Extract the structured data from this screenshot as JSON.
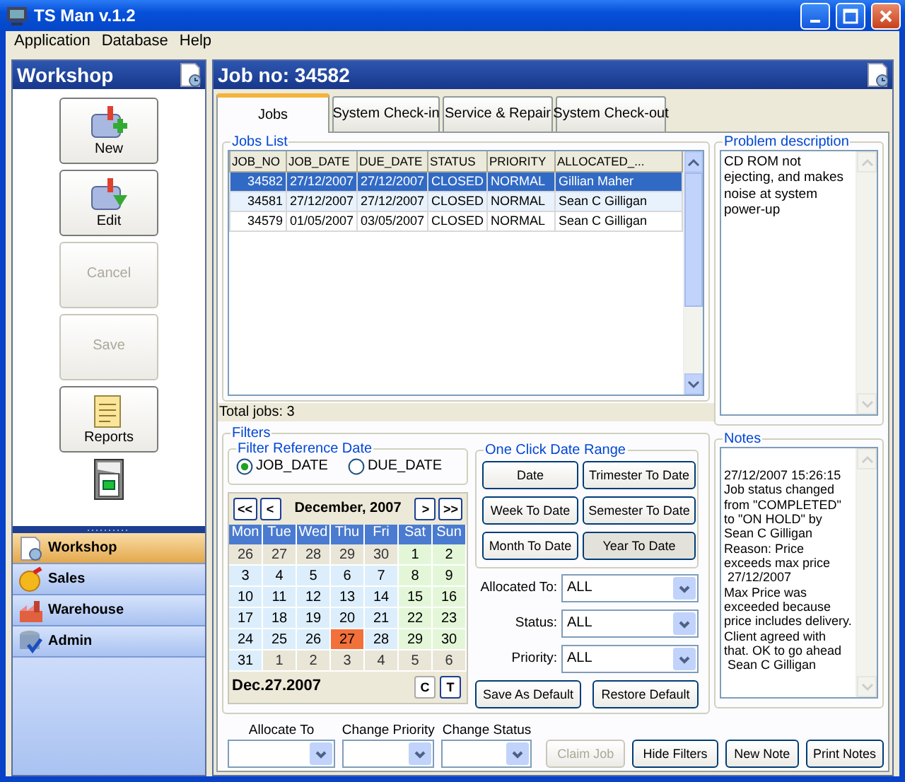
{
  "window": {
    "title": "TS Man v.1.2"
  },
  "menu": [
    "Application",
    "Database",
    "Help"
  ],
  "sidebar": {
    "title": "Workshop",
    "buttons": [
      {
        "label": "New",
        "disabled": false
      },
      {
        "label": "Edit",
        "disabled": false
      },
      {
        "label": "Cancel",
        "disabled": true
      },
      {
        "label": "Save",
        "disabled": true
      },
      {
        "label": "Reports",
        "disabled": false
      }
    ],
    "modules": [
      {
        "label": "Workshop",
        "selected": true
      },
      {
        "label": "Sales",
        "selected": false
      },
      {
        "label": "Warehouse",
        "selected": false
      },
      {
        "label": "Admin",
        "selected": false
      }
    ]
  },
  "job_panel": {
    "title": "Job no: 34582",
    "tabs": [
      {
        "label": "Jobs",
        "selected": true
      },
      {
        "label": "System Check-in",
        "selected": false
      },
      {
        "label": "Service & Repair",
        "selected": false
      },
      {
        "label": "System Check-out",
        "selected": false
      }
    ],
    "jobs_list": {
      "title": "Jobs List",
      "columns": [
        "JOB_NO",
        "JOB_DATE",
        "DUE_DATE",
        "STATUS",
        "PRIORITY",
        "ALLOCATED_..."
      ],
      "rows": [
        {
          "cells": [
            "34582",
            "27/12/2007",
            "27/12/2007",
            "CLOSED",
            "NORMAL",
            "Gillian Maher"
          ],
          "selected": true
        },
        {
          "cells": [
            "34581",
            "27/12/2007",
            "27/12/2007",
            "CLOSED",
            "NORMAL",
            "Sean C Gilligan"
          ],
          "selected": false
        },
        {
          "cells": [
            "34579",
            "01/05/2007",
            "03/05/2007",
            "CLOSED",
            "NORMAL",
            "Sean C Gilligan"
          ],
          "selected": false
        }
      ],
      "total": "Total jobs: 3"
    },
    "problem_description": {
      "title": "Problem description",
      "text": "CD ROM not ejecting, and makes noise at system power-up"
    },
    "filters": {
      "title": "Filters",
      "reference_date": {
        "title": "Filter Reference Date",
        "options": [
          {
            "label": "JOB_DATE",
            "selected": true
          },
          {
            "label": "DUE_DATE",
            "selected": false
          }
        ]
      },
      "calendar": {
        "prev_year": "<<",
        "prev_month": "<",
        "month": "December, 2007",
        "next_month": ">",
        "next_year": ">>",
        "weekdays": [
          "Mon",
          "Tue",
          "Wed",
          "Thu",
          "Fri",
          "Sat",
          "Sun"
        ],
        "weeks": [
          [
            {
              "day": "26",
              "other_month": true,
              "selected": false
            },
            {
              "day": "27",
              "other_month": true,
              "selected": false
            },
            {
              "day": "28",
              "other_month": true,
              "selected": false
            },
            {
              "day": "29",
              "other_month": true,
              "selected": false
            },
            {
              "day": "30",
              "other_month": true,
              "selected": false
            },
            {
              "day": "1",
              "other_month": false,
              "selected": false
            },
            {
              "day": "2",
              "other_month": false,
              "selected": false
            }
          ],
          [
            {
              "day": "3",
              "other_month": false,
              "selected": false
            },
            {
              "day": "4",
              "other_month": false,
              "selected": false
            },
            {
              "day": "5",
              "other_month": false,
              "selected": false
            },
            {
              "day": "6",
              "other_month": false,
              "selected": false
            },
            {
              "day": "7",
              "other_month": false,
              "selected": false
            },
            {
              "day": "8",
              "other_month": false,
              "selected": false
            },
            {
              "day": "9",
              "other_month": false,
              "selected": false
            }
          ],
          [
            {
              "day": "10",
              "other_month": false,
              "selected": false
            },
            {
              "day": "11",
              "other_month": false,
              "selected": false
            },
            {
              "day": "12",
              "other_month": false,
              "selected": false
            },
            {
              "day": "13",
              "other_month": false,
              "selected": false
            },
            {
              "day": "14",
              "other_month": false,
              "selected": false
            },
            {
              "day": "15",
              "other_month": false,
              "selected": false
            },
            {
              "day": "16",
              "other_month": false,
              "selected": false
            }
          ],
          [
            {
              "day": "17",
              "other_month": false,
              "selected": false
            },
            {
              "day": "18",
              "other_month": false,
              "selected": false
            },
            {
              "day": "19",
              "other_month": false,
              "selected": false
            },
            {
              "day": "20",
              "other_month": false,
              "selected": false
            },
            {
              "day": "21",
              "other_month": false,
              "selected": false
            },
            {
              "day": "22",
              "other_month": false,
              "selected": false
            },
            {
              "day": "23",
              "other_month": false,
              "selected": false
            }
          ],
          [
            {
              "day": "24",
              "other_month": false,
              "selected": false
            },
            {
              "day": "25",
              "other_month": false,
              "selected": false
            },
            {
              "day": "26",
              "other_month": false,
              "selected": false
            },
            {
              "day": "27",
              "other_month": false,
              "selected": true
            },
            {
              "day": "28",
              "other_month": false,
              "selected": false
            },
            {
              "day": "29",
              "other_month": false,
              "selected": false
            },
            {
              "day": "30",
              "other_month": false,
              "selected": false
            }
          ],
          [
            {
              "day": "31",
              "other_month": false,
              "selected": false
            },
            {
              "day": "1",
              "other_month": true,
              "selected": false
            },
            {
              "day": "2",
              "other_month": true,
              "selected": false
            },
            {
              "day": "3",
              "other_month": true,
              "selected": false
            },
            {
              "day": "4",
              "other_month": true,
              "selected": false
            },
            {
              "day": "5",
              "other_month": true,
              "selected": false
            },
            {
              "day": "6",
              "other_month": true,
              "selected": false
            }
          ]
        ],
        "selected_date": "Dec.27.2007",
        "clear_button": "C",
        "today_button": "T"
      },
      "date_range": {
        "title": "One Click Date Range",
        "buttons": [
          {
            "label": "Date",
            "pressed": false
          },
          {
            "label": "Trimester To Date",
            "pressed": false
          },
          {
            "label": "Week To Date",
            "pressed": false
          },
          {
            "label": "Semester To Date",
            "pressed": false
          },
          {
            "label": "Month To Date",
            "pressed": false
          },
          {
            "label": "Year To Date",
            "pressed": true
          }
        ]
      },
      "fields": [
        {
          "label": "Allocated To:",
          "value": "ALL"
        },
        {
          "label": "Status:",
          "value": "ALL"
        },
        {
          "label": "Priority:",
          "value": "ALL"
        }
      ],
      "buttons": [
        "Save As Default",
        "Restore Default"
      ]
    },
    "notes": {
      "title": "Notes",
      "lines": [
        "27/12/2007 15:26:15",
        "Job status changed from \"COMPLETED\" to \"ON HOLD\" by Sean C Gilligan",
        "Reason: Price exceeds max price",
        " 27/12/2007",
        "Max Price was exceeded because price includes delivery.",
        "Client agreed with that. OK to go ahead",
        " Sean C Gilligan"
      ]
    },
    "actions": {
      "fields": [
        {
          "label": "Allocate To"
        },
        {
          "label": "Change Priority"
        },
        {
          "label": "Change Status"
        }
      ],
      "buttons": [
        {
          "label": "Claim Job",
          "disabled": true
        },
        {
          "label": "Hide Filters",
          "disabled": false
        },
        {
          "label": "New Note",
          "disabled": false
        },
        {
          "label": "Print Notes",
          "disabled": false
        }
      ]
    }
  }
}
